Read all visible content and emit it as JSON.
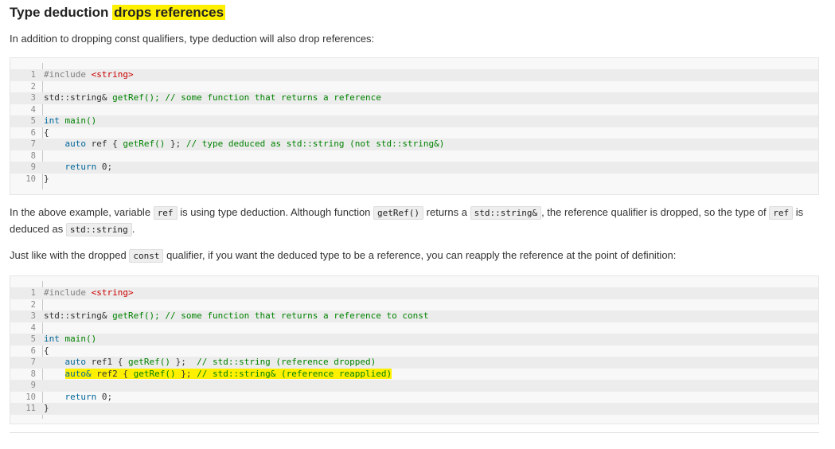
{
  "heading": {
    "plain": "Type deduction",
    "highlighted": "drops references"
  },
  "intro": "In addition to dropping const qualifiers, type deduction will also drop references:",
  "code1": {
    "lines": [
      {
        "n": "1",
        "text": ""
      },
      {
        "n": "2",
        "text": ""
      },
      {
        "n": "3",
        "text": ""
      },
      {
        "n": "4",
        "text": ""
      },
      {
        "n": "5",
        "text": ""
      },
      {
        "n": "6",
        "text": ""
      },
      {
        "n": "7",
        "text": ""
      },
      {
        "n": "8",
        "text": ""
      },
      {
        "n": "9",
        "text": ""
      },
      {
        "n": "10",
        "text": ""
      }
    ],
    "include_kw": "#include",
    "include_file": "<string>",
    "decl_type": "std::string&",
    "decl_fn": "getRef();",
    "decl_comment": "// some function that returns a reference",
    "main_kw": "int",
    "main_fn": "main()",
    "open_brace": "{",
    "auto_kw": "auto",
    "ref_decl": "ref { ",
    "ref_call": "getRef()",
    "ref_tail": " };",
    "ref_comment": "// type deduced as std::string (not std::string&)",
    "return_kw": "return",
    "return_val": " 0;",
    "close_brace": "}"
  },
  "para2": {
    "t1": "In the above example, variable",
    "c1": "ref",
    "t2": "is using type deduction. Although function",
    "c2": "getRef()",
    "t3": "returns a",
    "c3": "std::string&",
    "t4": ", the reference qualifier is dropped, so the type of",
    "c4": "ref",
    "t5": "is",
    "t6": "deduced as",
    "c5": "std::string",
    "t7": "."
  },
  "para3": {
    "t1": "Just like with the dropped",
    "c1": "const",
    "t2": "qualifier, if you want the deduced type to be a reference, you can reapply the reference at the point of definition:"
  },
  "code2": {
    "numbers": [
      "1",
      "2",
      "3",
      "4",
      "5",
      "6",
      "7",
      "8",
      "9",
      "10",
      "11"
    ],
    "include_kw": "#include",
    "include_file": "<string>",
    "decl_type": "std::string&",
    "decl_fn": "getRef();",
    "decl_comment": "// some function that returns a reference to const",
    "main_kw": "int",
    "main_fn": "main()",
    "open_brace": "{",
    "auto1_kw": "auto",
    "ref1_decl": "ref1 { ",
    "ref1_call": "getRef()",
    "ref1_tail": " };  ",
    "ref1_comment": "// std::string (reference dropped)",
    "auto2_kw": "auto&",
    "ref2_decl": " ref2 { ",
    "ref2_call": "getRef()",
    "ref2_tail": " }; ",
    "ref2_comment": "// std::string& (reference reapplied)",
    "return_kw": "return",
    "return_val": " 0;",
    "close_brace": "}"
  },
  "colors": {
    "highlight": "#fff000",
    "keyword": "#006699",
    "comment": "#008200",
    "string": "#cc0000"
  }
}
